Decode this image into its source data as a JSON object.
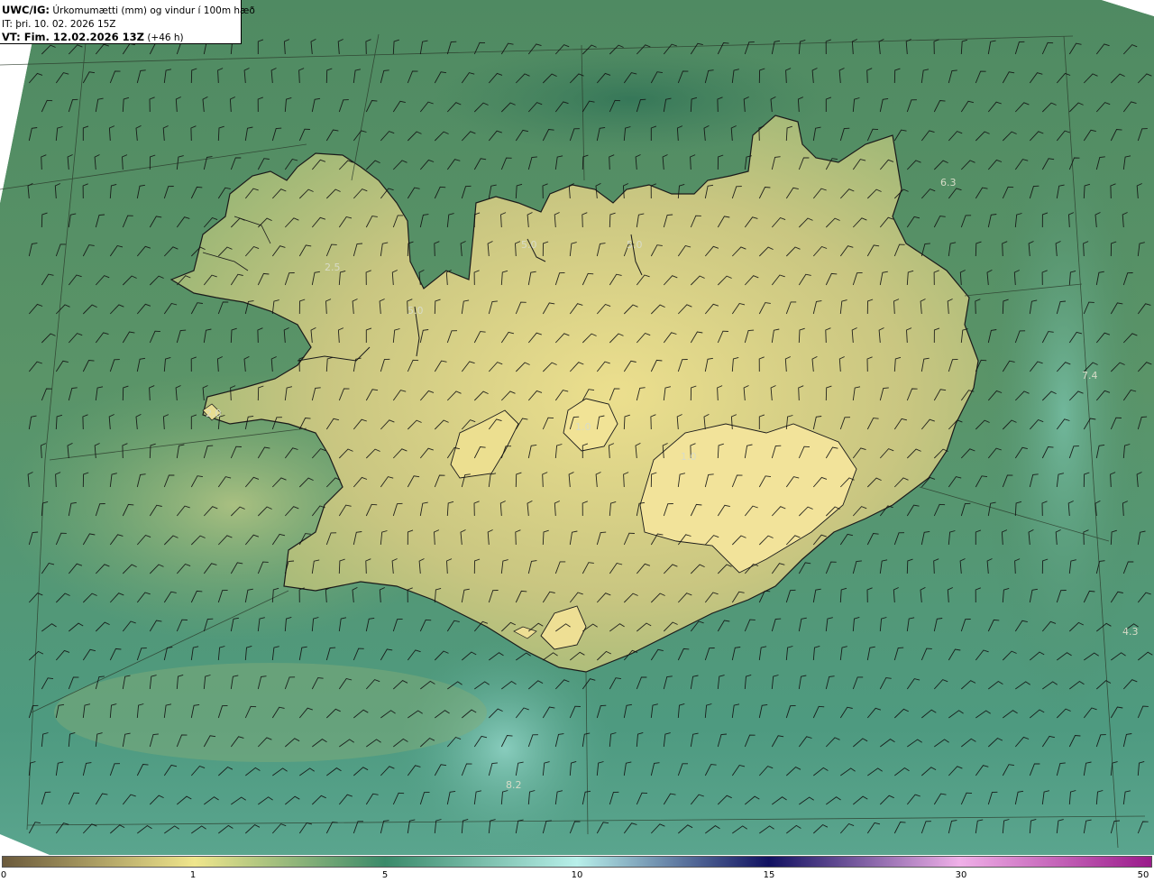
{
  "title": {
    "model": "UWC/IG:",
    "field": "Úrkomumætti (mm) og vindur í 100m hæð",
    "issue_time": "IT: þri. 10. 02. 2026 15Z",
    "valid_label": "VT: Fim. 12.02.2026 13Z",
    "valid_offset": "(+46 h)"
  },
  "colorbar": {
    "ticks": [
      "0",
      "1",
      "5",
      "10",
      "15",
      "30",
      "50"
    ],
    "colors": [
      "#6b5a3c",
      "#f0e68c",
      "#3a8a6a",
      "#b8f0ea",
      "#101060",
      "#f0b0e8",
      "#9a1a8a"
    ]
  },
  "maxima_labels": [
    "2.5",
    "5.0",
    "5.0",
    "5.0",
    "2.0",
    "1.0",
    "1.0",
    "6.3",
    "7.4",
    "4.3",
    "8.2"
  ]
}
